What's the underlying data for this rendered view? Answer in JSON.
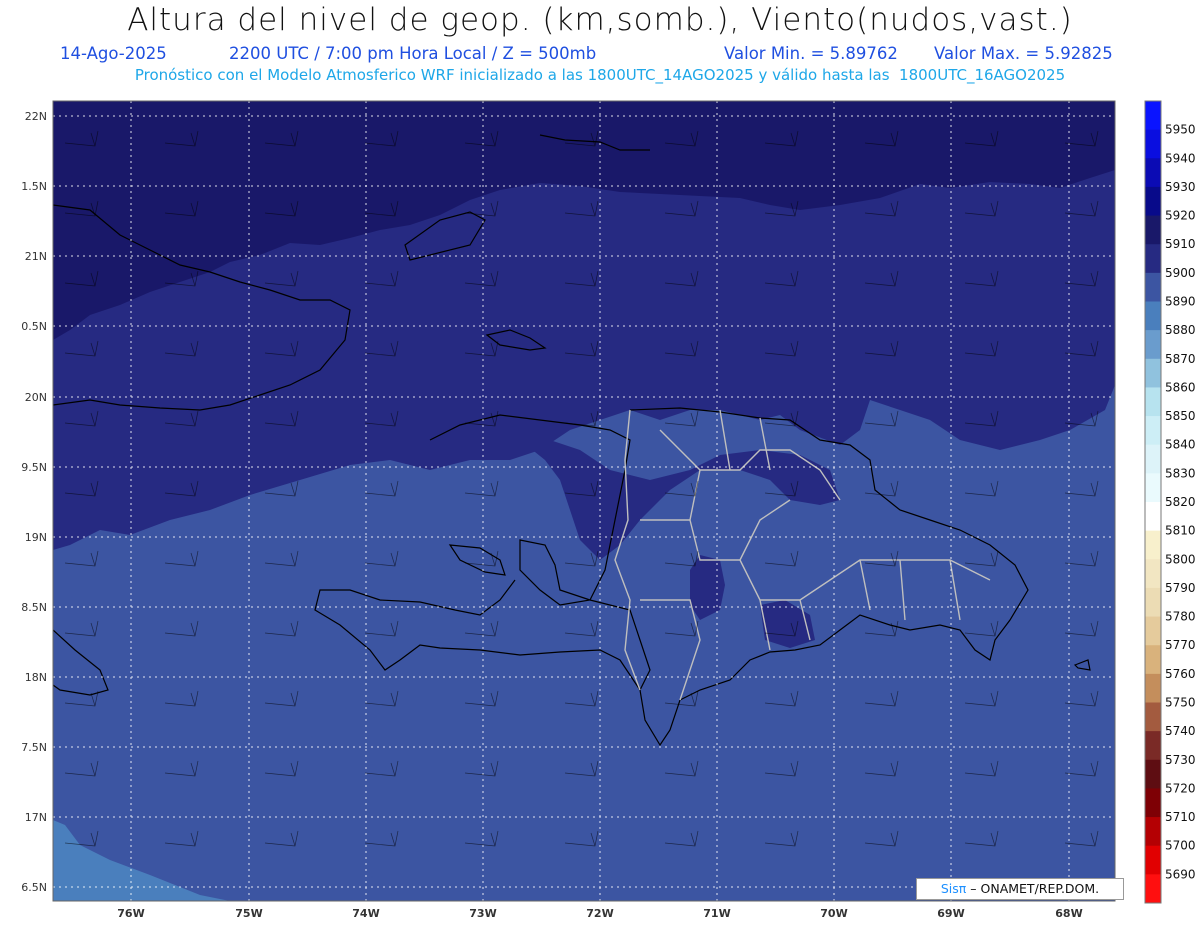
{
  "header": {
    "title": "Altura del nivel de geop. (km,somb.), Viento(nudos,vast.)",
    "date": "14-Ago-2025",
    "time": "2200 UTC / 7:00 pm Hora Local / Z = 500mb",
    "min_label": "Valor Min. = 5.89762",
    "max_label": "Valor Max. = 5.92825",
    "model_line": "Pronóstico con el Modelo Atmosferico WRF inicializado a las 1800UTC_14AGO2025 y válido hasta las  1800UTC_16AGO2025"
  },
  "axes": {
    "lat_labels": [
      "22N",
      "1.5N",
      "21N",
      "0.5N",
      "20N",
      "9.5N",
      "19N",
      "8.5N",
      "18N",
      "7.5N",
      "17N",
      "6.5N"
    ],
    "lon_labels": [
      "76W",
      "75W",
      "74W",
      "73W",
      "72W",
      "71W",
      "70W",
      "69W",
      "68W"
    ]
  },
  "colorbar": {
    "levels": [
      5950,
      5940,
      5930,
      5920,
      5910,
      5900,
      5890,
      5880,
      5870,
      5860,
      5850,
      5840,
      5830,
      5820,
      5810,
      5800,
      5790,
      5780,
      5770,
      5760,
      5750,
      5740,
      5730,
      5720,
      5710,
      5700,
      5690
    ],
    "colors": [
      "#0a14ff",
      "#0a0ee0",
      "#0b0bb4",
      "#080a8a",
      "#191869",
      "#262a82",
      "#3c55a2",
      "#4a7fbd",
      "#6a9ccd",
      "#90c2de",
      "#b7e3ef",
      "#cdeef6",
      "#ddf3f9",
      "#eafafd",
      "#ffffff",
      "#f8f0cc",
      "#f2e6c2",
      "#ecdcb4",
      "#e5cb9c",
      "#d9b27c",
      "#c48e5c",
      "#a35b3f",
      "#7a2a26",
      "#5e0d12",
      "#7e0005",
      "#b40003",
      "#e10001",
      "#ff0f0f"
    ]
  },
  "fill_colors": {
    "zone_5920": "#191869",
    "zone_5910": "#262a82",
    "zone_5900": "#3c55a2",
    "zone_5890": "#4a7fbd",
    "coast": "#000000",
    "border": "#bfbfbf"
  },
  "credit": {
    "logo": "Sisπ",
    "text": "– ONAMET/REP.DOM."
  }
}
